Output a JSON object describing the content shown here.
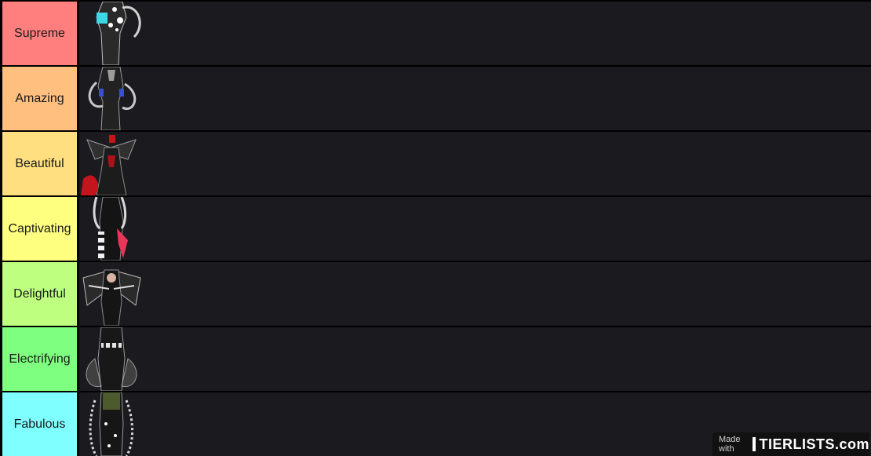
{
  "tiers": [
    {
      "label": "Supreme",
      "color": "#ff7f7f",
      "item_icon": "character-figure-icon"
    },
    {
      "label": "Amazing",
      "color": "#ffbf7f",
      "item_icon": "character-figure-icon"
    },
    {
      "label": "Beautiful",
      "color": "#ffdf7f",
      "item_icon": "character-figure-icon"
    },
    {
      "label": "Captivating",
      "color": "#ffff7f",
      "item_icon": "character-figure-icon"
    },
    {
      "label": "Delightful",
      "color": "#bfff7f",
      "item_icon": "character-figure-icon"
    },
    {
      "label": "Electrifying",
      "color": "#7fff7f",
      "item_icon": "character-figure-icon"
    },
    {
      "label": "Fabulous",
      "color": "#7fffff",
      "item_icon": "character-figure-icon"
    }
  ],
  "watermark": {
    "made_with": "Made with",
    "brand": "TIERLISTS.com"
  }
}
